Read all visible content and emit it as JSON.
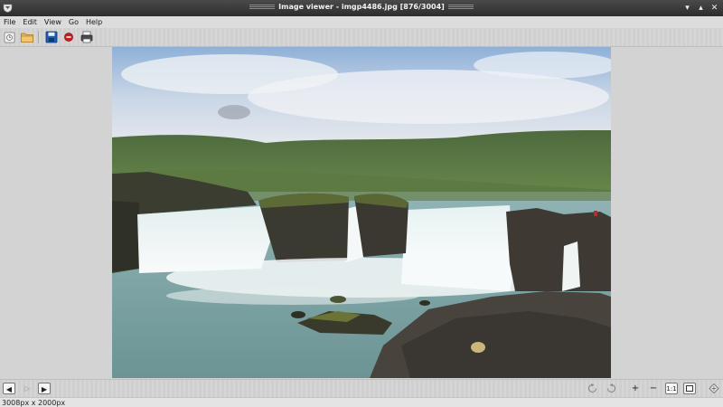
{
  "window": {
    "title": "Image viewer - imgp4486.jpg [876/3004]"
  },
  "window_controls": {
    "minimize": "▾",
    "maximize": "▴",
    "close": "✕"
  },
  "menu": {
    "items": [
      "File",
      "Edit",
      "View",
      "Go",
      "Help"
    ]
  },
  "toolbar": {
    "icons": [
      "open-recent-icon",
      "open-folder-icon",
      "save-icon",
      "stop-icon",
      "print-icon"
    ]
  },
  "image": {
    "file_name": "imgp4486.jpg",
    "index": 876,
    "total": 3004,
    "description_subject": "waterfall"
  },
  "navigation": {
    "prev": "◀",
    "play": "▷",
    "next": "▶"
  },
  "zoom_controls": {
    "zoom_in": "+",
    "zoom_out": "−",
    "actual_size": "1:1"
  },
  "status": {
    "dimensions": "3008px x 2000px"
  },
  "colors": {
    "titlebar": "#2d2d2d",
    "save_icon": "#1a5fb4",
    "stop_icon": "#d01b1b"
  }
}
